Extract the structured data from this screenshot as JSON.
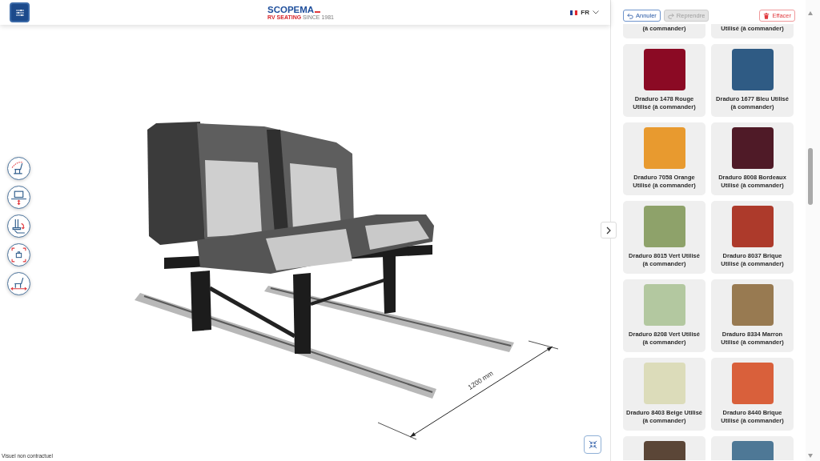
{
  "header": {
    "logo": {
      "name": "SCOPEMA",
      "tagline": "**RV SEATING** SINCE 1981"
    },
    "language": {
      "code": "FR"
    }
  },
  "viewer": {
    "dimension": "1200 mm",
    "disclaimer": "Visuel non contractuel"
  },
  "panel": {
    "actions": [
      {
        "kind": "undo",
        "label": "Annuler",
        "disabled": false
      },
      {
        "kind": "redo",
        "label": "Reprendre",
        "disabled": true
      },
      {
        "kind": "clear",
        "label": "Effacer",
        "disabled": false
      }
    ],
    "fabrics": [
      {
        "label": "(à commander)",
        "selected": false
      },
      {
        "label": "Utilisé (à commander)",
        "selected": false
      },
      {
        "label": "Draduro 1478 Rouge Utilisé (à commander)",
        "color": "#8b0a24",
        "selected": false
      },
      {
        "label": "Draduro 1677 Bleu Utilisé (à commander)",
        "color": "#2f5b84",
        "selected": false
      },
      {
        "label": "Draduro 7058 Orange Utilisé (à commander)",
        "color": "#e89a2f",
        "selected": false
      },
      {
        "label": "Draduro 8008 Bordeaux Utilisé (à commander)",
        "color": "#4f1a27",
        "selected": false
      },
      {
        "label": "Draduro 8015 Vert Utilisé (à commander)",
        "color": "#8ea26a",
        "selected": false
      },
      {
        "label": "Draduro 8037 Brique Utilisé (à commander)",
        "color": "#ad3a2b",
        "selected": false
      },
      {
        "label": "Draduro 8208 Vert Utilisé (à commander)",
        "color": "#b3c8a0",
        "selected": false
      },
      {
        "label": "Draduro 8334 Marron Utilisé (à commander)",
        "color": "#987a51",
        "selected": false
      },
      {
        "label": "Draduro 8403 Beige Utilisé (à commander)",
        "color": "#dcdcba",
        "selected": false
      },
      {
        "label": "Draduro 8440 Brique Utilisé (à commander)",
        "color": "#d9603b",
        "selected": false
      },
      {
        "color": "#5b4637",
        "selected": false
      },
      {
        "color": "#4e7896",
        "selected": false
      }
    ]
  }
}
